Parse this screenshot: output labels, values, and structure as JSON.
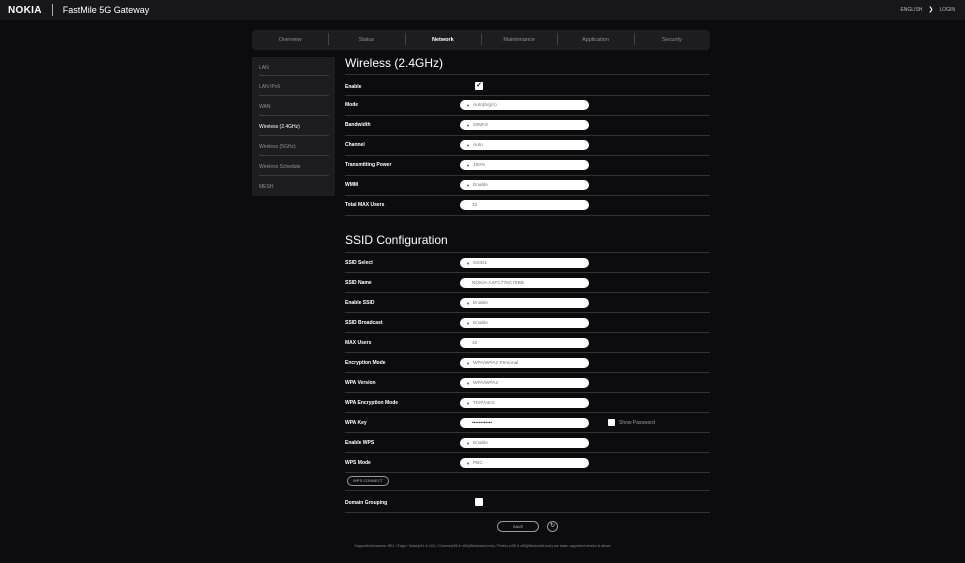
{
  "header": {
    "brand": "NOKIA",
    "product": "FastMile 5G Gateway",
    "language": "ENGLISH",
    "login": "LOGIN"
  },
  "tabs": [
    {
      "label": "Overview",
      "active": false
    },
    {
      "label": "Status",
      "active": false
    },
    {
      "label": "Network",
      "active": true
    },
    {
      "label": "Maintenance",
      "active": false
    },
    {
      "label": "Application",
      "active": false
    },
    {
      "label": "Security",
      "active": false
    }
  ],
  "sidebar": {
    "items": [
      {
        "label": "LAN",
        "active": false
      },
      {
        "label": "LAN IPv6",
        "active": false
      },
      {
        "label": "WAN",
        "active": false
      },
      {
        "label": "Wireless (2.4GHz)",
        "active": true
      },
      {
        "label": "Wireless (5GHz)",
        "active": false
      },
      {
        "label": "Wireless Schedule",
        "active": false
      },
      {
        "label": "MESH",
        "active": false
      }
    ]
  },
  "wireless": {
    "title": "Wireless (2.4GHz)",
    "enable_label": "Enable",
    "enable_checked": true,
    "mode_label": "Mode",
    "mode_value": "Auto(b/g/n)",
    "bandwidth_label": "Bandwidth",
    "bandwidth_value": "20MHz",
    "channel_label": "Channel",
    "channel_value": "Auto",
    "power_label": "Transmitting Power",
    "power_value": "100%",
    "wmm_label": "WMM",
    "wmm_value": "Enable",
    "max_users_label": "Total MAX Users",
    "max_users_value": "32"
  },
  "ssid": {
    "title": "SSID Configuration",
    "select_label": "SSID Select",
    "select_value": "SSID1",
    "name_label": "SSID Name",
    "name_value": "NOKIA-A4FC776C79BB",
    "enable_label": "Enable SSID",
    "enable_value": "Enable",
    "broadcast_label": "SSID Broadcast",
    "broadcast_value": "Enable",
    "max_users_label": "MAX Users",
    "max_users_value": "32",
    "enc_mode_label": "Encryption Mode",
    "enc_mode_value": "WPA/WPA2 Personal",
    "wpa_version_label": "WPA Version",
    "wpa_version_value": "WPA/WPA2",
    "wpa_enc_label": "WPA Encryption Mode",
    "wpa_enc_value": "TKIP/AES",
    "wpa_key_label": "WPA Key",
    "wpa_key_value": "••••••••••••",
    "show_password_label": "Show Password",
    "wps_enable_label": "Enable WPS",
    "wps_enable_value": "Enable",
    "wps_mode_label": "WPS Mode",
    "wps_mode_value": "PBC",
    "wps_connect_label": "WPS CONNECT",
    "domain_grouping_label": "Domain Grouping",
    "domain_grouping_checked": false
  },
  "actions": {
    "save_label": "SAVE",
    "refresh_icon": "↻"
  },
  "footer": {
    "text": "Supported browsers: IE11 / Edge / Safari(v11 & v10) / Chrome(v55 & v65)(Windows/Linux) / Firefox (v55 & v60)(Windows/Linux) are basic supported version & above"
  },
  "colors": {
    "background": "#0c0c0e",
    "panel": "#1d1d20",
    "field": "#ffffff"
  }
}
